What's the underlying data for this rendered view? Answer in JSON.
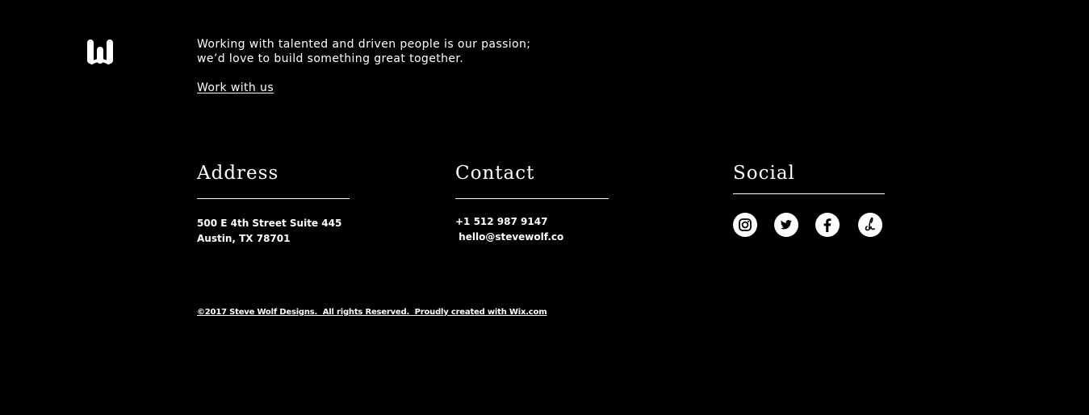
{
  "brand": {
    "logo_icon": "steve-wolf-logo-icon"
  },
  "intro": {
    "line1": "Working with talented and driven people is our passion;",
    "line2": "we’d love to build something great together.",
    "cta": "Work with us"
  },
  "address": {
    "heading": "Address",
    "line1": "500 E 4th Street Suite 445",
    "line2": "Austin, TX 78701"
  },
  "contact": {
    "heading": "Contact",
    "phone": "+1 512 987 9147",
    "email": " hello@stevewolf.co"
  },
  "social": {
    "heading": "Social",
    "icons": [
      "instagram-icon",
      "twitter-icon",
      "facebook-icon",
      "dribbble-icon"
    ]
  },
  "footer": {
    "copyright": "©2017 Steve Wolf Designs.  All rights Reserved.  Proudly created with Wix.com"
  },
  "colors": {
    "background": "#000000",
    "foreground": "#ffffff"
  }
}
